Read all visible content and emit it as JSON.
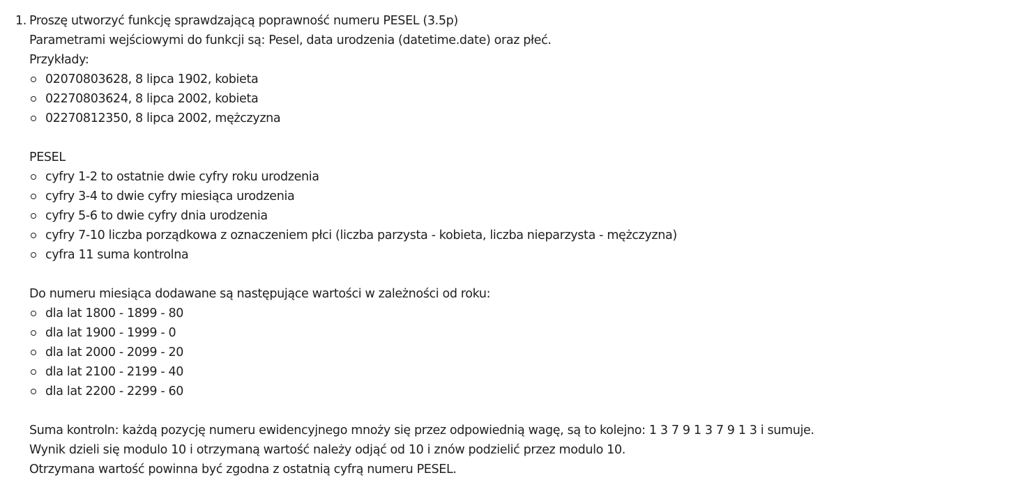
{
  "task": {
    "number": "1.",
    "title": "Proszę utworzyć funkcję sprawdzającą poprawność numeru PESEL (3.5p)",
    "params": "Parametrami wejściowymi do funkcji są: Pesel, data urodzenia (datetime.date) oraz płeć.",
    "examples_heading": "Przykłady:",
    "examples": [
      "02070803628, 8 lipca 1902, kobieta",
      "02270803624, 8 lipca 2002, kobieta",
      "02270812350, 8 lipca 2002, mężczyzna"
    ],
    "pesel_heading": "PESEL",
    "pesel_items": [
      "cyfry 1-2 to ostatnie dwie cyfry roku urodzenia",
      "cyfry 3-4 to dwie cyfry miesiąca urodzenia",
      "cyfry 5-6 to dwie cyfry dnia urodzenia",
      "cyfry 7-10 liczba porządkowa z oznaczeniem płci (liczba parzysta - kobieta, liczba nieparzysta - mężczyzna)",
      "cyfra 11 suma kontrolna"
    ],
    "month_heading": "Do numeru miesiąca dodawane są następujące wartości w zależności od roku:",
    "month_items": [
      "dla lat 1800 - 1899 - 80",
      "dla lat 1900 - 1999 - 0",
      "dla lat 2000 - 2099 - 20",
      "dla lat 2100 - 2199 - 40",
      "dla lat 2200 - 2299 - 60"
    ],
    "checksum_lines": [
      "Suma kontroln: każdą pozycję numeru ewidencyjnego mnoży się przez odpowiednią wagę, są to kolejno: 1 3 7 9 1 3 7 9 1 3 i sumuje.",
      "Wynik dzieli się modulo 10 i otrzymaną wartość należy odjąć od 10 i znów podzielić przez modulo 10.",
      "Otrzymana wartość powinna być zgodna z ostatnią cyfrą numeru PESEL."
    ]
  }
}
